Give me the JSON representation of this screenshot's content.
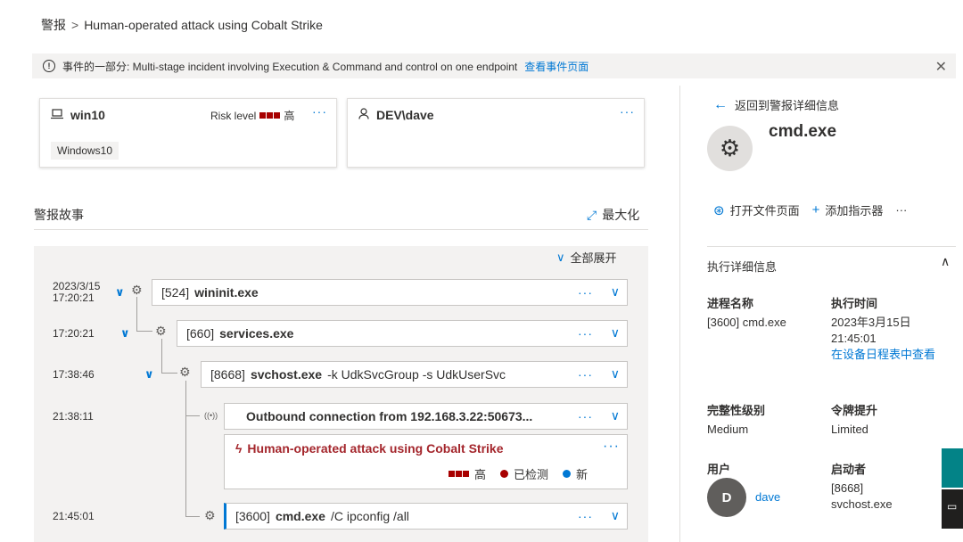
{
  "breadcrumb": {
    "root": "警报",
    "separator": ">",
    "current": "Human-operated attack using Cobalt Strike"
  },
  "banner": {
    "text": "事件的一部分: Multi-stage incident involving Execution & Command and control on one endpoint",
    "link": "查看事件页面"
  },
  "device_card": {
    "name": "win10",
    "risk_label": "Risk level",
    "risk_value": "高",
    "tag": "Windows10"
  },
  "user_card": {
    "name": "DEV\\dave"
  },
  "story": {
    "title": "警报故事",
    "maximize": "最大化",
    "expand_all": "全部展开",
    "rows": [
      {
        "date": "2023/3/15",
        "time": "17:20:21",
        "pid": "[524]",
        "name": "wininit.exe",
        "args": ""
      },
      {
        "time": "17:20:21",
        "pid": "[660]",
        "name": "services.exe",
        "args": ""
      },
      {
        "time": "17:38:46",
        "pid": "[8668]",
        "name": "svchost.exe",
        "args": "-k UdkSvcGroup -s UdkUserSvc"
      },
      {
        "time": "21:38:11",
        "pid": "",
        "name": "Outbound connection from 192.168.3.22:50673...",
        "args": ""
      },
      {
        "time": "21:45:01",
        "pid": "[3600]",
        "name": "cmd.exe",
        "args": "/C ipconfig /all"
      }
    ],
    "alert": {
      "title": "Human-operated attack using Cobalt Strike",
      "severity": "高",
      "status": "已检测",
      "state": "新"
    }
  },
  "panel": {
    "back": "返回到警报详细信息",
    "title": "cmd.exe",
    "actions": {
      "open_file": "打开文件页面",
      "add_indicator": "添加指示器"
    },
    "section_title": "执行详细信息",
    "process_name_label": "进程名称",
    "process_name_value": "[3600] cmd.exe",
    "exec_time_label": "执行时间",
    "exec_time_date": "2023年3月15日",
    "exec_time_time": "21:45:01",
    "exec_time_link": "在设备日程表中查看",
    "integrity_label": "完整性级别",
    "integrity_value": "Medium",
    "token_label": "令牌提升",
    "token_value": "Limited",
    "user_label": "用户",
    "user_initial": "D",
    "user_value": "dave",
    "initiator_label": "启动者",
    "initiator_pid": "[8668]",
    "initiator_name": "svchost.exe"
  },
  "colors": {
    "accent": "#0078d4",
    "danger": "#a80000",
    "new": "#0078d4"
  }
}
